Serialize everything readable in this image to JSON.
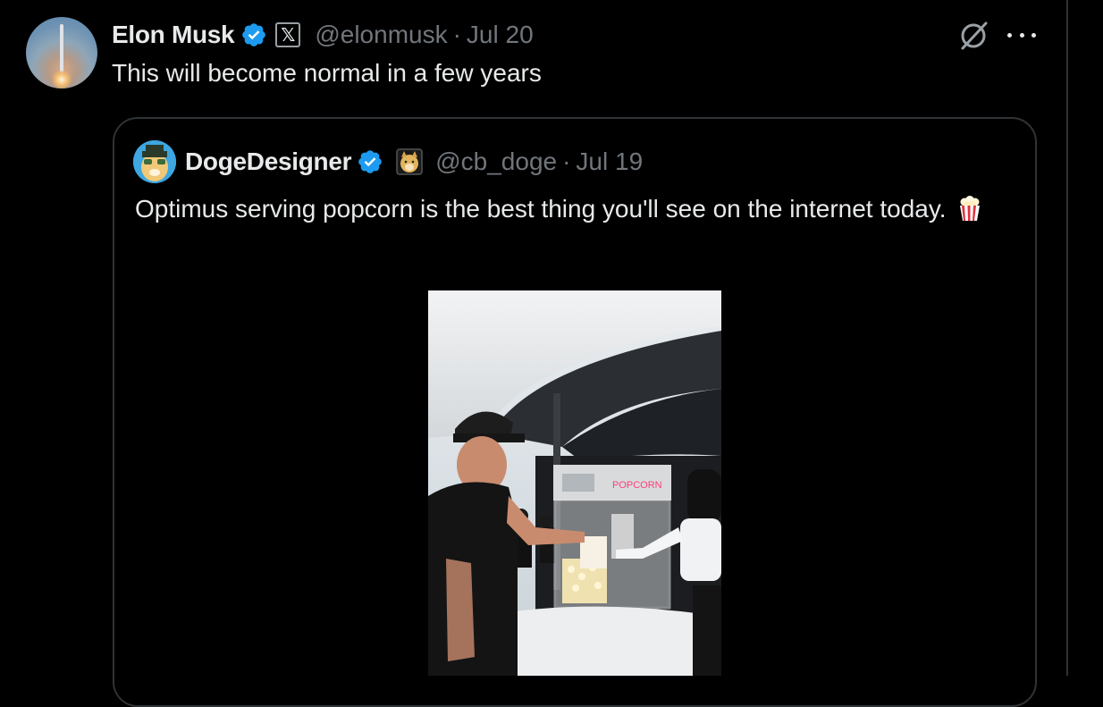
{
  "tweet": {
    "author_name": "Elon Musk",
    "handle": "@elonmusk",
    "separator": "·",
    "date": "Jul 20",
    "text": "This will become normal in a few years",
    "icons": {
      "verified": "verified-badge-icon",
      "affiliate": "x-logo-badge-icon",
      "grok": "grok-icon",
      "more": "more-icon"
    },
    "colors": {
      "verified_blue": "#1d9bf0",
      "secondary_text": "#71767b",
      "border": "#2f3336"
    }
  },
  "quoted_tweet": {
    "author_name": "DogeDesigner",
    "handle": "@cb_doge",
    "separator": "·",
    "date": "Jul 19",
    "text": "Optimus serving popcorn is the best thing you'll see on the internet today.",
    "emoji": "popcorn-icon",
    "media": {
      "sign_text": "POPCORN"
    }
  },
  "x_badge_glyph": "𝕏"
}
